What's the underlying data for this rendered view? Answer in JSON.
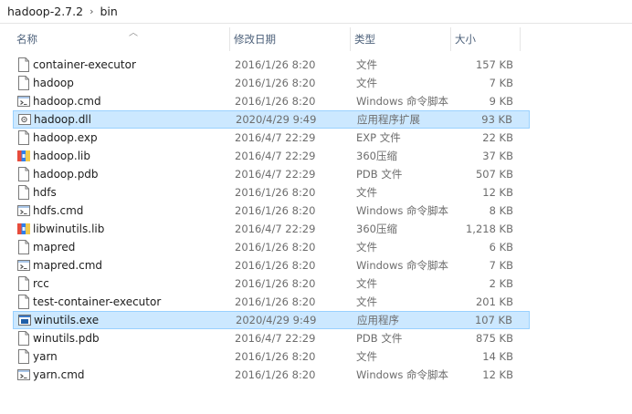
{
  "breadcrumb": {
    "parent": "hadoop-2.7.2",
    "current": "bin"
  },
  "columns": {
    "name": "名称",
    "date": "修改日期",
    "type": "类型",
    "size": "大小"
  },
  "files": [
    {
      "name": "container-executor",
      "date": "2016/1/26 8:20",
      "type": "文件",
      "size": "157 KB",
      "icon": "file-icon",
      "selected": false
    },
    {
      "name": "hadoop",
      "date": "2016/1/26 8:20",
      "type": "文件",
      "size": "7 KB",
      "icon": "file-icon",
      "selected": false
    },
    {
      "name": "hadoop.cmd",
      "date": "2016/1/26 8:20",
      "type": "Windows 命令脚本",
      "size": "9 KB",
      "icon": "script-file-icon",
      "selected": false
    },
    {
      "name": "hadoop.dll",
      "date": "2020/4/29 9:49",
      "type": "应用程序扩展",
      "size": "93 KB",
      "icon": "dll-file-icon",
      "selected": true
    },
    {
      "name": "hadoop.exp",
      "date": "2016/4/7 22:29",
      "type": "EXP 文件",
      "size": "22 KB",
      "icon": "file-icon",
      "selected": false
    },
    {
      "name": "hadoop.lib",
      "date": "2016/4/7 22:29",
      "type": "360压缩",
      "size": "37 KB",
      "icon": "archive-icon",
      "selected": false
    },
    {
      "name": "hadoop.pdb",
      "date": "2016/4/7 22:29",
      "type": "PDB 文件",
      "size": "507 KB",
      "icon": "file-icon",
      "selected": false
    },
    {
      "name": "hdfs",
      "date": "2016/1/26 8:20",
      "type": "文件",
      "size": "12 KB",
      "icon": "file-icon",
      "selected": false
    },
    {
      "name": "hdfs.cmd",
      "date": "2016/1/26 8:20",
      "type": "Windows 命令脚本",
      "size": "8 KB",
      "icon": "script-file-icon",
      "selected": false
    },
    {
      "name": "libwinutils.lib",
      "date": "2016/4/7 22:29",
      "type": "360压缩",
      "size": "1,218 KB",
      "icon": "archive-icon",
      "selected": false
    },
    {
      "name": "mapred",
      "date": "2016/1/26 8:20",
      "type": "文件",
      "size": "6 KB",
      "icon": "file-icon",
      "selected": false
    },
    {
      "name": "mapred.cmd",
      "date": "2016/1/26 8:20",
      "type": "Windows 命令脚本",
      "size": "7 KB",
      "icon": "script-file-icon",
      "selected": false
    },
    {
      "name": "rcc",
      "date": "2016/1/26 8:20",
      "type": "文件",
      "size": "2 KB",
      "icon": "file-icon",
      "selected": false
    },
    {
      "name": "test-container-executor",
      "date": "2016/1/26 8:20",
      "type": "文件",
      "size": "201 KB",
      "icon": "file-icon",
      "selected": false
    },
    {
      "name": "winutils.exe",
      "date": "2020/4/29 9:49",
      "type": "应用程序",
      "size": "107 KB",
      "icon": "exe-icon",
      "selected": true
    },
    {
      "name": "winutils.pdb",
      "date": "2016/4/7 22:29",
      "type": "PDB 文件",
      "size": "875 KB",
      "icon": "file-icon",
      "selected": false
    },
    {
      "name": "yarn",
      "date": "2016/1/26 8:20",
      "type": "文件",
      "size": "14 KB",
      "icon": "file-icon",
      "selected": false
    },
    {
      "name": "yarn.cmd",
      "date": "2016/1/26 8:20",
      "type": "Windows 命令脚本",
      "size": "12 KB",
      "icon": "script-file-icon",
      "selected": false
    }
  ],
  "colors": {
    "selected_bg": "#cce8ff",
    "selected_border": "#99d1ff",
    "header_text": "#4c607a"
  }
}
